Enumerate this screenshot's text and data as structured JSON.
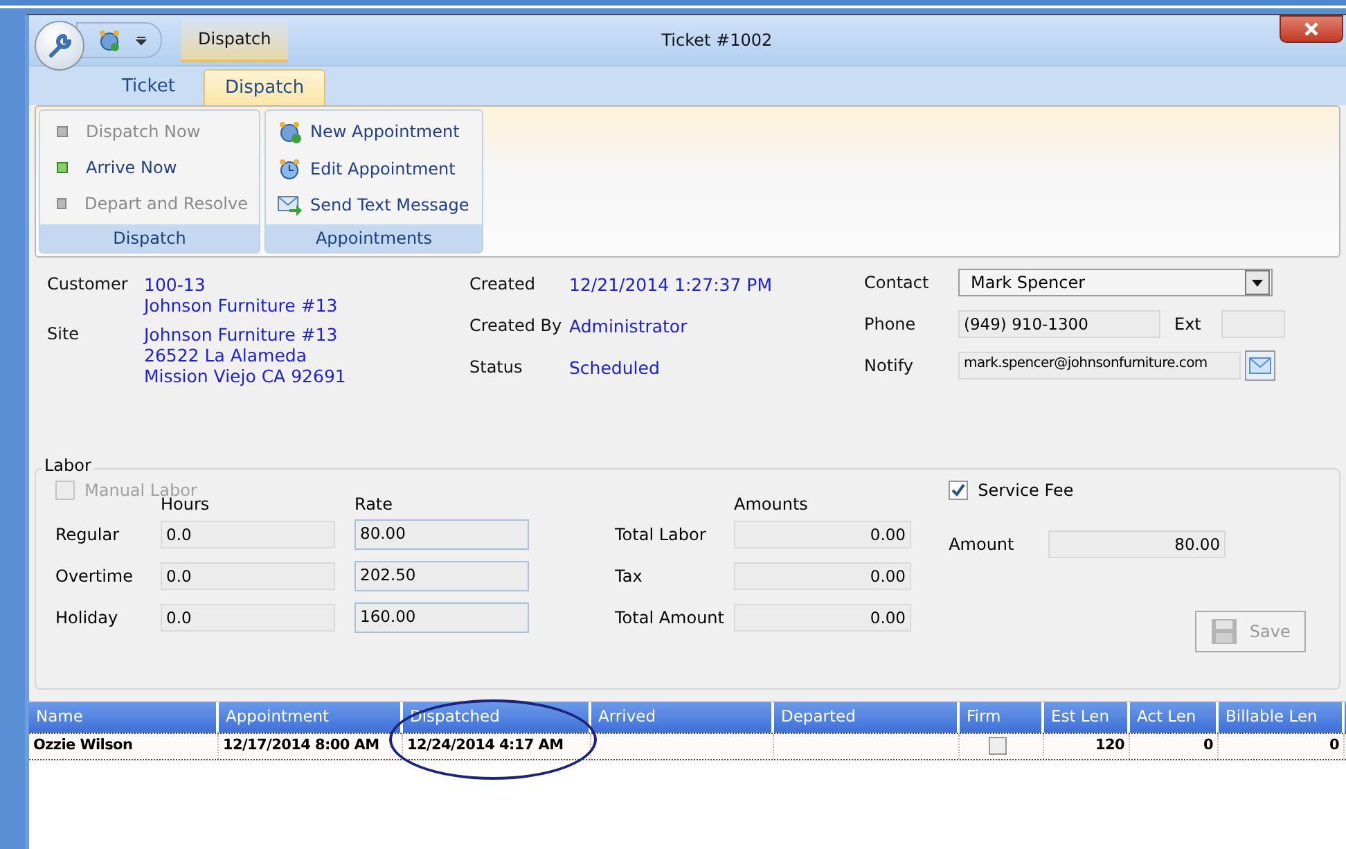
{
  "window": {
    "context_tab": "Dispatch",
    "title": "Ticket #1002"
  },
  "tabs": [
    {
      "label": "Ticket",
      "selected": false
    },
    {
      "label": "Dispatch",
      "selected": true
    }
  ],
  "ribbon_groups": [
    {
      "label": "Dispatch",
      "items": [
        {
          "label": "Dispatch Now",
          "kind": "dot",
          "disabled": true
        },
        {
          "label": "Arrive Now",
          "kind": "dot",
          "disabled": false
        },
        {
          "label": "Depart and Resolve",
          "kind": "dot",
          "disabled": true
        }
      ]
    },
    {
      "label": "Appointments",
      "items": [
        {
          "label": "New Appointment",
          "kind": "clock-add",
          "disabled": false
        },
        {
          "label": "Edit Appointment",
          "kind": "clock",
          "disabled": false
        },
        {
          "label": "Send Text Message",
          "kind": "mail",
          "disabled": false
        }
      ]
    }
  ],
  "info": {
    "customer_label": "Customer",
    "customer": [
      "100-13",
      "Johnson Furniture #13"
    ],
    "site_label": "Site",
    "site": [
      "Johnson Furniture #13",
      "26522 La Alameda",
      "Mission Viejo CA 92691"
    ],
    "created_label": "Created",
    "created": "12/21/2014 1:27:37 PM",
    "created_by_label": "Created By",
    "created_by": "Administrator",
    "status_label": "Status",
    "status": "Scheduled",
    "contact_label": "Contact",
    "contact": "Mark Spencer",
    "phone_label": "Phone",
    "phone": "(949) 910-1300",
    "ext_label": "Ext",
    "notify_label": "Notify",
    "notify": "mark.spencer@johnsonfurniture.com"
  },
  "labor": {
    "title": "Labor",
    "manual_labor": {
      "label": "Manual Labor",
      "checked": false,
      "disabled": true
    },
    "hours_label": "Hours",
    "rate_label": "Rate",
    "amounts_label": "Amounts",
    "rows": [
      {
        "label": "Regular",
        "hours": "0.0",
        "rate": "80.00",
        "total_label": "Total Labor",
        "total": "0.00"
      },
      {
        "label": "Overtime",
        "hours": "0.0",
        "rate": "202.50",
        "total_label": "Tax",
        "total": "0.00"
      },
      {
        "label": "Holiday",
        "hours": "0.0",
        "rate": "160.00",
        "total_label": "Total Amount",
        "total": "0.00"
      }
    ],
    "service_fee": {
      "label": "Service Fee",
      "checked": true
    },
    "amount_label": "Amount",
    "amount": "80.00",
    "save": {
      "label": "Save",
      "disabled": true
    }
  },
  "table": {
    "columns": [
      "Name",
      "Appointment",
      "Dispatched",
      "Arrived",
      "Departed",
      "Firm",
      "Est Len",
      "Act Len",
      "Billable Len"
    ],
    "rows": [
      {
        "name": "Ozzie Wilson",
        "appointment": "12/17/2014 8:00 AM",
        "dispatched": "12/24/2014 4:17 AM",
        "firm": false,
        "est_len": "120",
        "act_len": "0",
        "billable_len": "0"
      }
    ],
    "circled_columns": [
      false,
      false,
      true,
      false,
      false,
      false,
      false,
      false,
      false
    ]
  }
}
